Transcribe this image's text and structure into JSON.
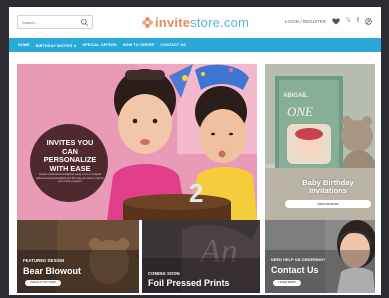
{
  "header": {
    "search_placeholder": "Search...",
    "logo_part1": "invite",
    "logo_part2": "store.com",
    "login_label": "LOGIN / REGISTER",
    "icons": [
      "heart-icon",
      "twitter-icon",
      "facebook-icon",
      "pinterest-icon"
    ]
  },
  "nav": {
    "items": [
      "HOME",
      "BIRTHDAY INVITES ∨",
      "SPECIAL OFFERS",
      "HOW TO ORDER",
      "CONTACT US"
    ]
  },
  "hero": {
    "title": "INVITES YOU CAN PERSONALIZE WITH EASE",
    "description": "Create customized invitations using a one or original artwork and personalized just the way you want it right to your online program."
  },
  "side": {
    "card_name": "ABIGAIL",
    "card_age": "ONE",
    "title": "Baby Birthday Invitations",
    "button_label": "VIEW DESIGNS"
  },
  "tiles": {
    "featured": {
      "small": "FEATURED DESIGN",
      "big": "Bear Blowout",
      "button": "CHECK IT OUT NOW"
    },
    "coming": {
      "small": "COMING SOON",
      "big": "Foil Pressed Prints"
    },
    "help": {
      "small": "NEED HELP ON ORDERING?",
      "big": "Contact Us",
      "button": "LEARN MORE"
    }
  },
  "colors": {
    "nav_bg": "#28a9d8",
    "logo_orange": "#e58c57",
    "logo_blue": "#55b7d6"
  }
}
